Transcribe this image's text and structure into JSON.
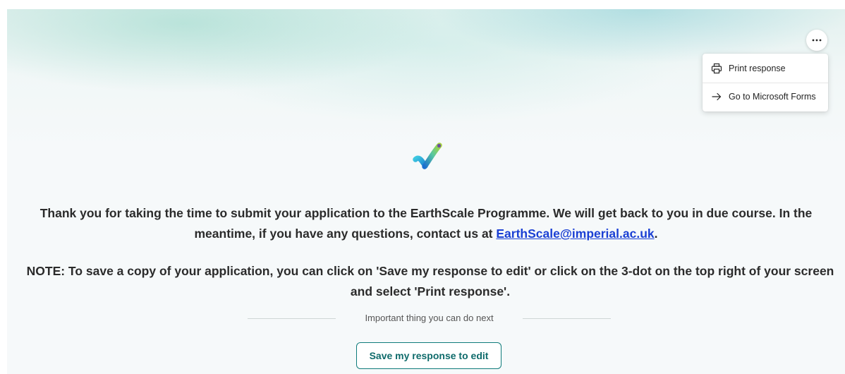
{
  "menu": {
    "more_button_icon": "more-horizontal-icon",
    "items": [
      {
        "label": "Print response",
        "icon": "printer-icon"
      },
      {
        "label": "Go to Microsoft Forms",
        "icon": "arrow-right-icon"
      }
    ]
  },
  "confirmation": {
    "icon": "checkmark-icon",
    "message_line1": "Thank you for taking the time to submit your application to the EarthScale Programme. We will get back to you in due course. In the",
    "message_line2_prefix": "meantime, if you have any questions, contact us at ",
    "email": "EarthScale@imperial.ac.uk",
    "message_line2_suffix": ".",
    "note_line1": "NOTE: To save a copy of your application, you can click on 'Save my response to edit' or click on the 3-dot on the top right of your screen",
    "note_line2": "and select 'Print response'."
  },
  "next_steps": {
    "label": "Important thing you can do next",
    "save_button_label": "Save my response to edit"
  },
  "colors": {
    "accent": "#0f7b7b",
    "link": "#1a3fd4",
    "text": "#2b2b2b"
  }
}
